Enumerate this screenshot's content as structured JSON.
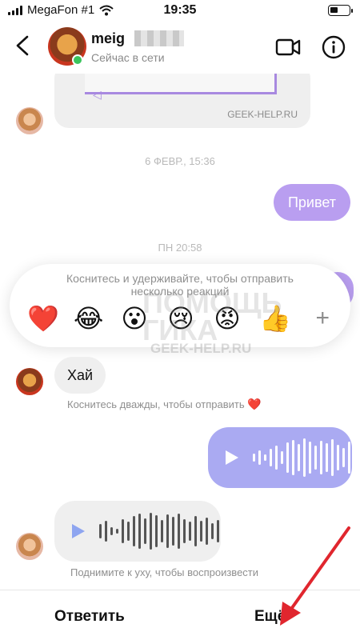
{
  "status_bar": {
    "carrier": "MegaFon #1",
    "time": "19:35"
  },
  "header": {
    "username": "meig",
    "presence": "Сейчас в сети"
  },
  "shared_post": {
    "watermark": "GEEK-HELP.RU"
  },
  "timestamps": [
    "6 ФЕВР., 15:36",
    "ПН 20:58"
  ],
  "messages": {
    "outgoing_text": "Привет",
    "incoming_text": "Хай"
  },
  "reactions": {
    "hint": "Коснитесь и удерживайте, чтобы отправить несколько реакций",
    "emoji": [
      "❤️",
      "😂",
      "😮",
      "😢",
      "😡",
      "👍"
    ],
    "add": "+"
  },
  "watermark": {
    "line1": "ПОМОЩЬ",
    "line2": "ГИКА",
    "site": "GEEK-HELP.RU"
  },
  "double_tap_tip": "Коснитесь дважды, чтобы отправить",
  "double_tap_heart": "❤️",
  "listen_tip": "Поднимите к уху, чтобы воспроизвести",
  "actions": {
    "reply": "Ответить",
    "more": "Ещё"
  },
  "colors": {
    "accent": "#b99ef0",
    "voice_out": "#aaaaf2",
    "arrow": "#e0262e",
    "online": "#3ac45c"
  }
}
